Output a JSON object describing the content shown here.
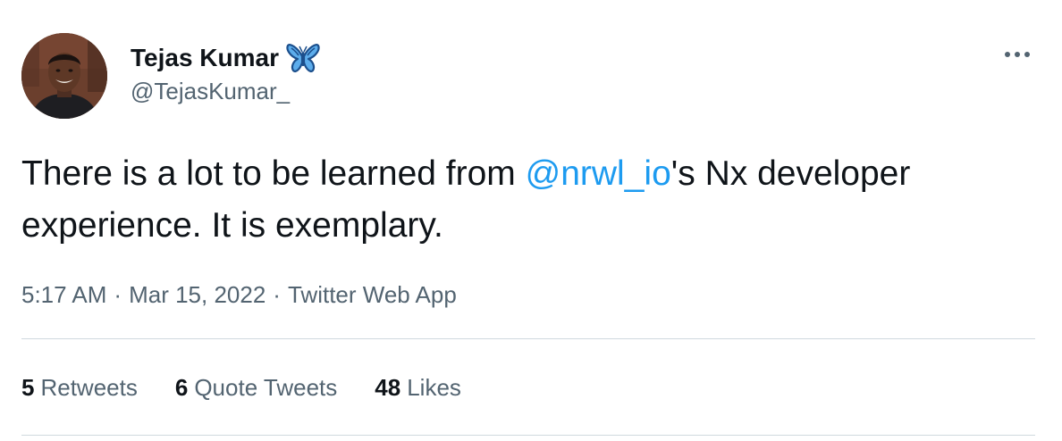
{
  "author": {
    "display_name": "Tejas Kumar",
    "handle": "@TejasKumar_",
    "badge_icon": "butterfly-icon",
    "badge_color": "#3b88c3"
  },
  "menu": {
    "more_icon": "ellipsis-icon"
  },
  "tweet": {
    "text_before": "There is a lot to be learned from ",
    "mention": "@nrwl_io",
    "text_after": "'s Nx developer experience. It is exemplary.",
    "mention_color": "#1d9bf0"
  },
  "meta": {
    "time": "5:17 AM",
    "separator": "·",
    "date": "Mar 15, 2022",
    "source": "Twitter Web App"
  },
  "stats": {
    "retweets_count": "5",
    "retweets_label": "Retweets",
    "quotes_count": "6",
    "quotes_label": "Quote Tweets",
    "likes_count": "48",
    "likes_label": "Likes"
  },
  "colors": {
    "text_primary": "#0f1419",
    "text_secondary": "#536471",
    "divider": "#cfd9de"
  }
}
